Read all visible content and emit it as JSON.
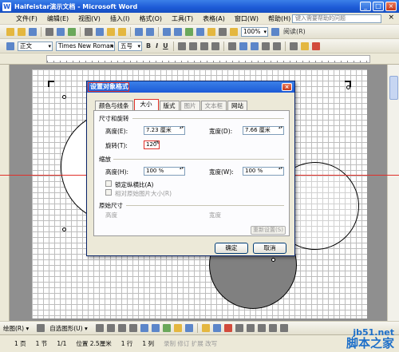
{
  "window": {
    "title": "Haifeistar演示文档 - Microsoft Word"
  },
  "menubar": {
    "items": [
      "文件(F)",
      "编辑(E)",
      "视图(V)",
      "插入(I)",
      "格式(O)",
      "工具(T)",
      "表格(A)",
      "窗口(W)",
      "帮助(H)"
    ],
    "help_placeholder": "键入需要帮助的问题"
  },
  "toolbar": {
    "zoom": "100%",
    "read": "阅读(R)"
  },
  "format_toolbar": {
    "style": "正文",
    "font": "Times New Roman",
    "size": "五号",
    "bold": "B",
    "italic": "I",
    "underline": "U"
  },
  "dialog": {
    "title": "设置对象格式",
    "tabs": [
      "颜色与线条",
      "大小",
      "版式",
      "图片",
      "文本框",
      "网站"
    ],
    "section_size": "尺寸和旋转",
    "height_label": "高度(E):",
    "height_value": "7.23 厘米",
    "width_label": "宽度(D):",
    "width_value": "7.66 厘米",
    "rotate_label": "旋转(T):",
    "rotate_value": "120°",
    "section_scale": "缩放",
    "scale_height_label": "高度(H):",
    "scale_height_value": "100 %",
    "scale_width_label": "宽度(W):",
    "scale_width_value": "100 %",
    "lock_ratio": "锁定纵横比(A)",
    "relative_original": "相对原始图片大小(R)",
    "section_original": "原始尺寸",
    "orig_height_label": "高度",
    "orig_width_label": "宽度",
    "reset_button": "重新设置(S)",
    "ok_button": "确定",
    "cancel_button": "取消"
  },
  "drawbar": {
    "draw": "绘图(R) ▾",
    "autoshapes": "自选图形(U) ▾"
  },
  "statusbar": {
    "page": "1 页",
    "section": "1 节",
    "page_of": "1/1",
    "position": "位置 2.5厘米",
    "line": "1 行",
    "col": "1 列",
    "flags": "录制 修订 扩展 改写"
  },
  "watermark": {
    "url": "jb51.net",
    "name": "脚本之家"
  }
}
